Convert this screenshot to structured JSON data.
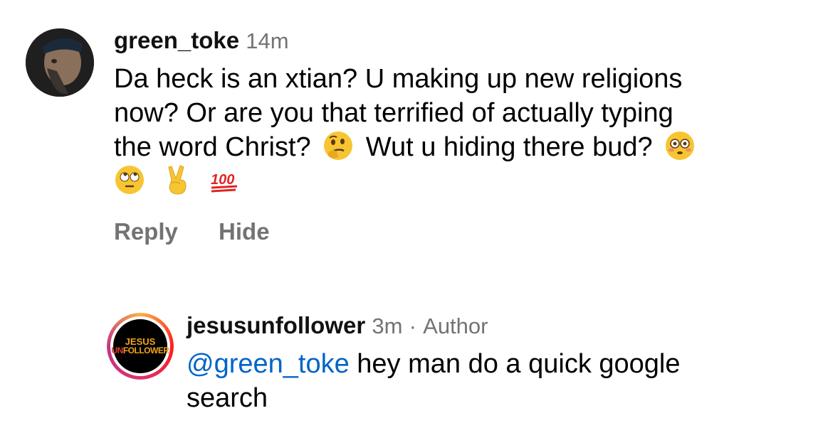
{
  "comment1": {
    "username": "green_toke",
    "time": "14m",
    "text_line1": "Da heck is an xtian? U making up new religions",
    "text_line2": "now? Or are you that terrified of actually typing",
    "text_line3a": "the word Christ?",
    "text_line3b": "Wut u hiding there bud?",
    "emojis": [
      "thinking-face",
      "flushed-face",
      "rolling-eyes-face",
      "victory-hand",
      "hundred-points"
    ],
    "actions": {
      "reply": "Reply",
      "hide": "Hide"
    }
  },
  "comment2": {
    "username": "jesusunfollower",
    "time": "3m",
    "separator": "·",
    "badge": "Author",
    "mention": "@green_toke",
    "text_line1": " hey man do a quick google",
    "text_line2": "search",
    "avatar_logo": {
      "top": "JESUS",
      "bottom_u": "UN",
      "bottom_rest": "FOLLOWER"
    }
  }
}
